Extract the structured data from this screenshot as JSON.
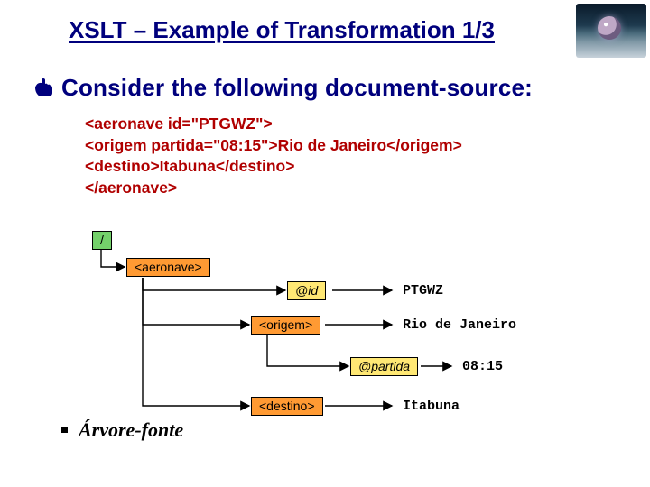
{
  "title": "XSLT – Example of Transformation 1/3",
  "subhead": "Consider the following document-source:",
  "code_lines": {
    "l1": "<aeronave id=\"PTGWZ\">",
    "l2": "<origem partida=\"08:15\">Rio de Janeiro</origem>",
    "l3": "<destino>Itabuna</destino>",
    "l4": "</aeronave>"
  },
  "tree": {
    "root": "/",
    "n_aeronave": "<aeronave>",
    "n_id": "@id",
    "v_id": "PTGWZ",
    "n_origem": "<origem>",
    "v_origem": "Rio de Janeiro",
    "n_partida": "@partida",
    "v_partida": "08:15",
    "n_destino": "<destino>",
    "v_destino": "Itabuna"
  },
  "caption": "Árvore-fonte"
}
